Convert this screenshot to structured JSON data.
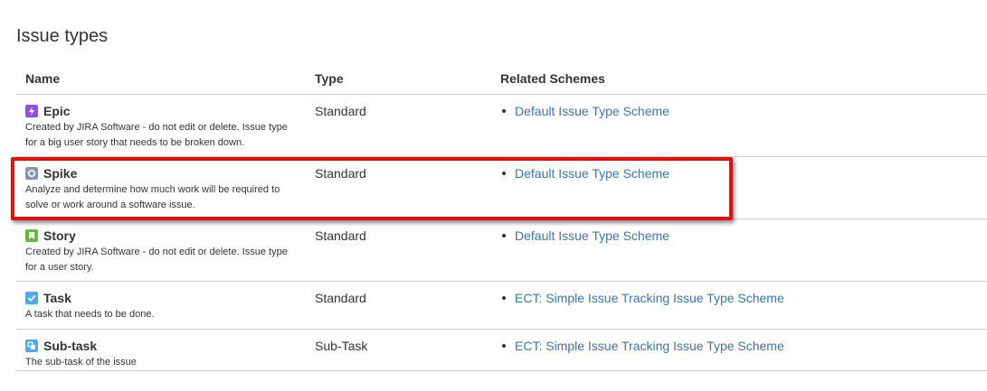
{
  "page": {
    "title": "Issue types"
  },
  "table": {
    "headers": {
      "name": "Name",
      "type": "Type",
      "schemes": "Related Schemes"
    },
    "rows": [
      {
        "icon": "epic-icon",
        "icon_color": "#904ee2",
        "name": "Epic",
        "description": "Created by JIRA Software - do not edit or delete. Issue type for a big user story that needs to be broken down.",
        "type": "Standard",
        "schemes": [
          "Default Issue Type Scheme"
        ]
      },
      {
        "icon": "spike-icon",
        "icon_color": "#8a96a8",
        "name": "Spike",
        "description": "Analyze and determine how much work will be required to solve or work around a software issue.",
        "type": "Standard",
        "schemes": [
          "Default Issue Type Scheme"
        ]
      },
      {
        "icon": "story-icon",
        "icon_color": "#63ba3c",
        "name": "Story",
        "description": "Created by JIRA Software - do not edit or delete. Issue type for a user story.",
        "type": "Standard",
        "schemes": [
          "Default Issue Type Scheme"
        ]
      },
      {
        "icon": "task-icon",
        "icon_color": "#4bade8",
        "name": "Task",
        "description": "A task that needs to be done.",
        "type": "Standard",
        "schemes": [
          "ECT: Simple Issue Tracking Issue Type Scheme"
        ]
      },
      {
        "icon": "subtask-icon",
        "icon_color": "#4bade8",
        "name": "Sub-task",
        "description": "The sub-task of the issue",
        "type": "Sub-Task",
        "schemes": [
          "ECT: Simple Issue Tracking Issue Type Scheme"
        ]
      }
    ]
  },
  "colors": {
    "link": "#3b73af",
    "highlight": "#e01010",
    "divider": "#cccccc"
  }
}
